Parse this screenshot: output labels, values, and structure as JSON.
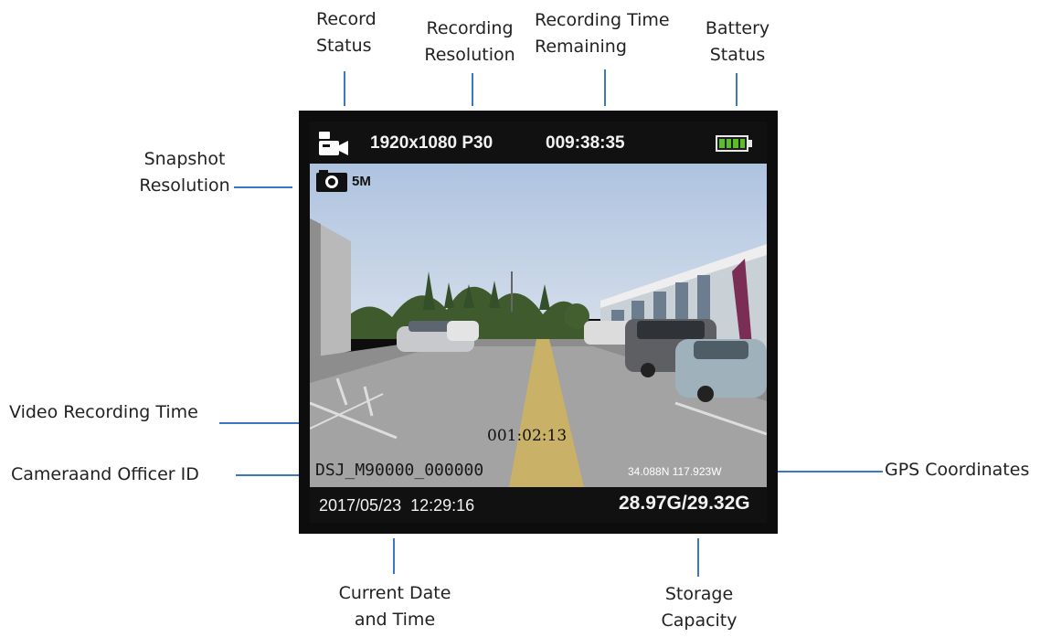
{
  "callouts": {
    "record_status": [
      "Record",
      "Status"
    ],
    "recording_resolution": [
      "Recording",
      "Resolution"
    ],
    "recording_time_remaining": [
      "Recording Time",
      "Remaining"
    ],
    "battery_status": [
      "Battery",
      "Status"
    ],
    "snapshot_resolution": [
      "Snapshot",
      "Resolution"
    ],
    "video_recording_time": "Video Recording Time",
    "camera_officer_id": "Cameraand Officer ID",
    "gps_coordinates": "GPS Coordinates",
    "current_date_time": [
      "Current Date",
      "and Time"
    ],
    "storage_capacity": [
      "Storage",
      "Capacity"
    ]
  },
  "screen": {
    "resolution": "1920x1080 P30",
    "time_remaining": "009:38:35",
    "snapshot_resolution": "5M",
    "recording_time": "001:02:13",
    "camera_officer_id": "DSJ_M90000_000000",
    "gps": "34.088N 117.923W",
    "datetime": "2017/05/23  12:29:16",
    "storage": "28.97G/29.32G",
    "battery_level": 1.0
  },
  "icons": {
    "record": "video-camera-icon",
    "snapshot": "camera-icon",
    "battery": "battery-icon"
  },
  "colors": {
    "leader_line": "#3a78c4",
    "battery_fill": "#5bbf2a",
    "center_line": "#c9b167"
  }
}
